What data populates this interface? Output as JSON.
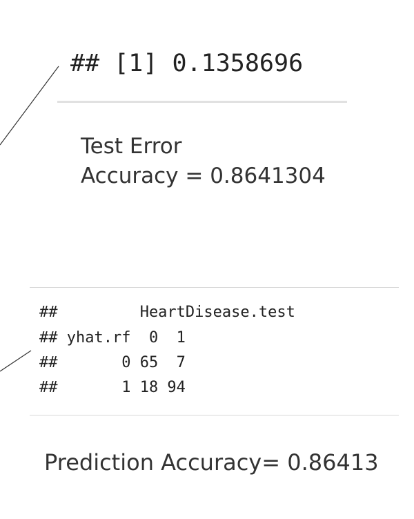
{
  "error_output": {
    "line": "## [1] 0.1358696"
  },
  "test_error": {
    "label": "Test Error",
    "accuracy_line": "Accuracy = 0.8641304"
  },
  "confusion_table": {
    "lines": [
      "##         HeartDisease.test",
      "## yhat.rf  0  1",
      "##       0 65  7",
      "##       1 18 94"
    ]
  },
  "prediction": {
    "text": "Prediction Accuracy= 0.86413"
  }
}
